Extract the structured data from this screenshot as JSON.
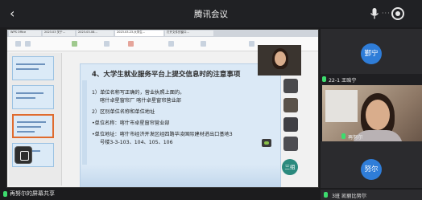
{
  "window": {
    "title": "腾讯会议"
  },
  "browser_tabs": [
    "WPS Office",
    "2023.03 关于…",
    "2023-03-08…",
    "2023.03.23-大学生…",
    "打开文件的窗口…"
  ],
  "slide": {
    "title": "4、大学生就业服务平台上提交信息时的注意事项",
    "lines": [
      "1）单位名称写正确的，营业执照上面的。",
      "喀什卓星窗帘厂   喀什卓星窗帘营业部",
      "2）区别单位名称和单位地址",
      "•单位名称：喀什市卓星窗帘营业部",
      "•单位地址：喀什市经济开发区经四路华凌国际建材进出口基地3",
      "号楼3-3-103、104、105、106"
    ]
  },
  "participants": [
    {
      "name": "鄞宁",
      "label": "",
      "type": "avatar"
    },
    {
      "name": "",
      "label": "22-1 王晗宁",
      "type": "label"
    },
    {
      "name": "",
      "label": "再努尔",
      "type": "label"
    },
    {
      "name": "三组",
      "label": "",
      "type": "avatar"
    },
    {
      "name": "努尔",
      "label": "",
      "type": "avatar"
    }
  ],
  "bottom": {
    "sharing_text": "再努尔的屏幕共享",
    "right_label": "3班 凯丽比努尔"
  },
  "colors": {
    "avatar_blue": "#2f7dd8",
    "mic_green": "#3ddc6e",
    "background": "#1c1c1e"
  }
}
